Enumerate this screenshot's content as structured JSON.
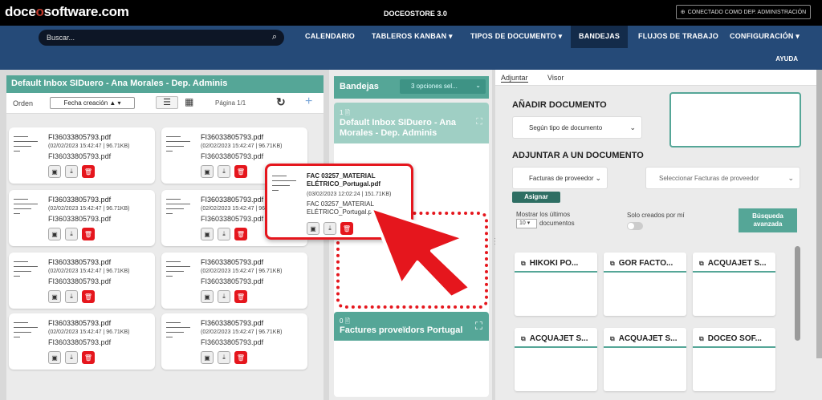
{
  "topbar": {
    "logo_pre": "doce",
    "logo_o": "o",
    "logo_post": "software.com",
    "store": "DOCEOSTORE 3.0",
    "connected": "CONECTADO COMO DEP. ADMINISTRACIÓN"
  },
  "navbar": {
    "search_placeholder": "Buscar...",
    "items": [
      "CALENDARIO",
      "TABLEROS KANBAN  ▾",
      "TIPOS DE DOCUMENTO  ▾",
      "BANDEJAS",
      "FLUJOS DE TRABAJO",
      "CONFIGURACIÓN  ▾"
    ],
    "active_item": "BANDEJAS",
    "help": "AYUDA"
  },
  "left_panel": {
    "title": "Default Inbox SIDuero - Ana Morales - Dep. Adminis",
    "order_label": "Orden",
    "sort_value": "Fecha creación ▲ ▾",
    "page": "Página 1/1",
    "documents": [
      {
        "name": "FI36033805793.pdf",
        "meta": "(02/02/2023 15:42:47 | 96.71KB)",
        "name2": "FI36033805793.pdf"
      },
      {
        "name": "FI36033805793.pdf",
        "meta": "(02/02/2023 15:42:47 | 96.71KB)",
        "name2": "FI36033805793.pdf"
      },
      {
        "name": "FI36033805793.pdf",
        "meta": "(02/02/2023 15:42:47 | 96.71KB)",
        "name2": "FI36033805793.pdf"
      },
      {
        "name": "FI36033805793.pdf",
        "meta": "(02/02/2023 15:42:47 | 96.71KB)",
        "name2": "FI36033805793.pdf"
      },
      {
        "name": "FI36033805793.pdf",
        "meta": "(02/02/2023 15:42:47 | 96.71KB)",
        "name2": "FI36033805793.pdf"
      },
      {
        "name": "FI36033805793.pdf",
        "meta": "(02/02/2023 15:42:47 | 96.71KB)",
        "name2": "FI36033805793.pdf"
      },
      {
        "name": "FI36033805793.pdf",
        "meta": "(02/02/2023 15:42:47 | 96.71KB)",
        "name2": "FI36033805793.pdf"
      },
      {
        "name": "FI36033805793.pdf",
        "meta": "(02/02/2023 15:42:47 | 96.71KB)",
        "name2": "FI36033805793.pdf"
      }
    ]
  },
  "dragged_document": {
    "name": "FAC 03257_MATERIAL ELÉTRICO_Portugal.pdf",
    "meta": "(03/02/2023 12:02:24 | 151.71KB)",
    "name2": "FAC 03257_MATERIAL ELÉTRICO_Portugal.pdf"
  },
  "middle_panel": {
    "title": "Bandejas",
    "selector": "3 opciones sel...",
    "trays": [
      {
        "count": "1 🖹",
        "name": "Default Inbox SIDuero - Ana Morales - Dep. Adminis",
        "color": "#9fcfc4"
      },
      {
        "count": "0 🖹",
        "name": "Factures proveïdors Portugal",
        "color": "#55a697"
      }
    ]
  },
  "right_panel": {
    "tabs": [
      "Adjuntar",
      "Visor"
    ],
    "active_tab": "Adjuntar",
    "add_doc_title": "AÑADIR DOCUMENTO",
    "add_doc_select": "Según tipo de documento",
    "attach_title": "ADJUNTAR A UN DOCUMENTO",
    "attach_type": "Facturas de proveedor",
    "attach_select": "Seleccionar Facturas de proveedor",
    "assign_button": "Asignar",
    "show_last_label": "Mostrar los últimos",
    "show_last_value": "10 ▾",
    "show_last_suffix": "documentos",
    "only_mine_label": "Solo creados por mí",
    "advanced_search": "Búsqueda avanzada",
    "cards": [
      "HIKOKI PO...",
      "GOR FACTO...",
      "ACQUAJET S...",
      "ACQUAJET S...",
      "ACQUAJET S...",
      "DOCEO SOF..."
    ]
  },
  "colors": {
    "accent": "#55a697",
    "nav": "#254a78",
    "highlight": "#e5161d"
  }
}
